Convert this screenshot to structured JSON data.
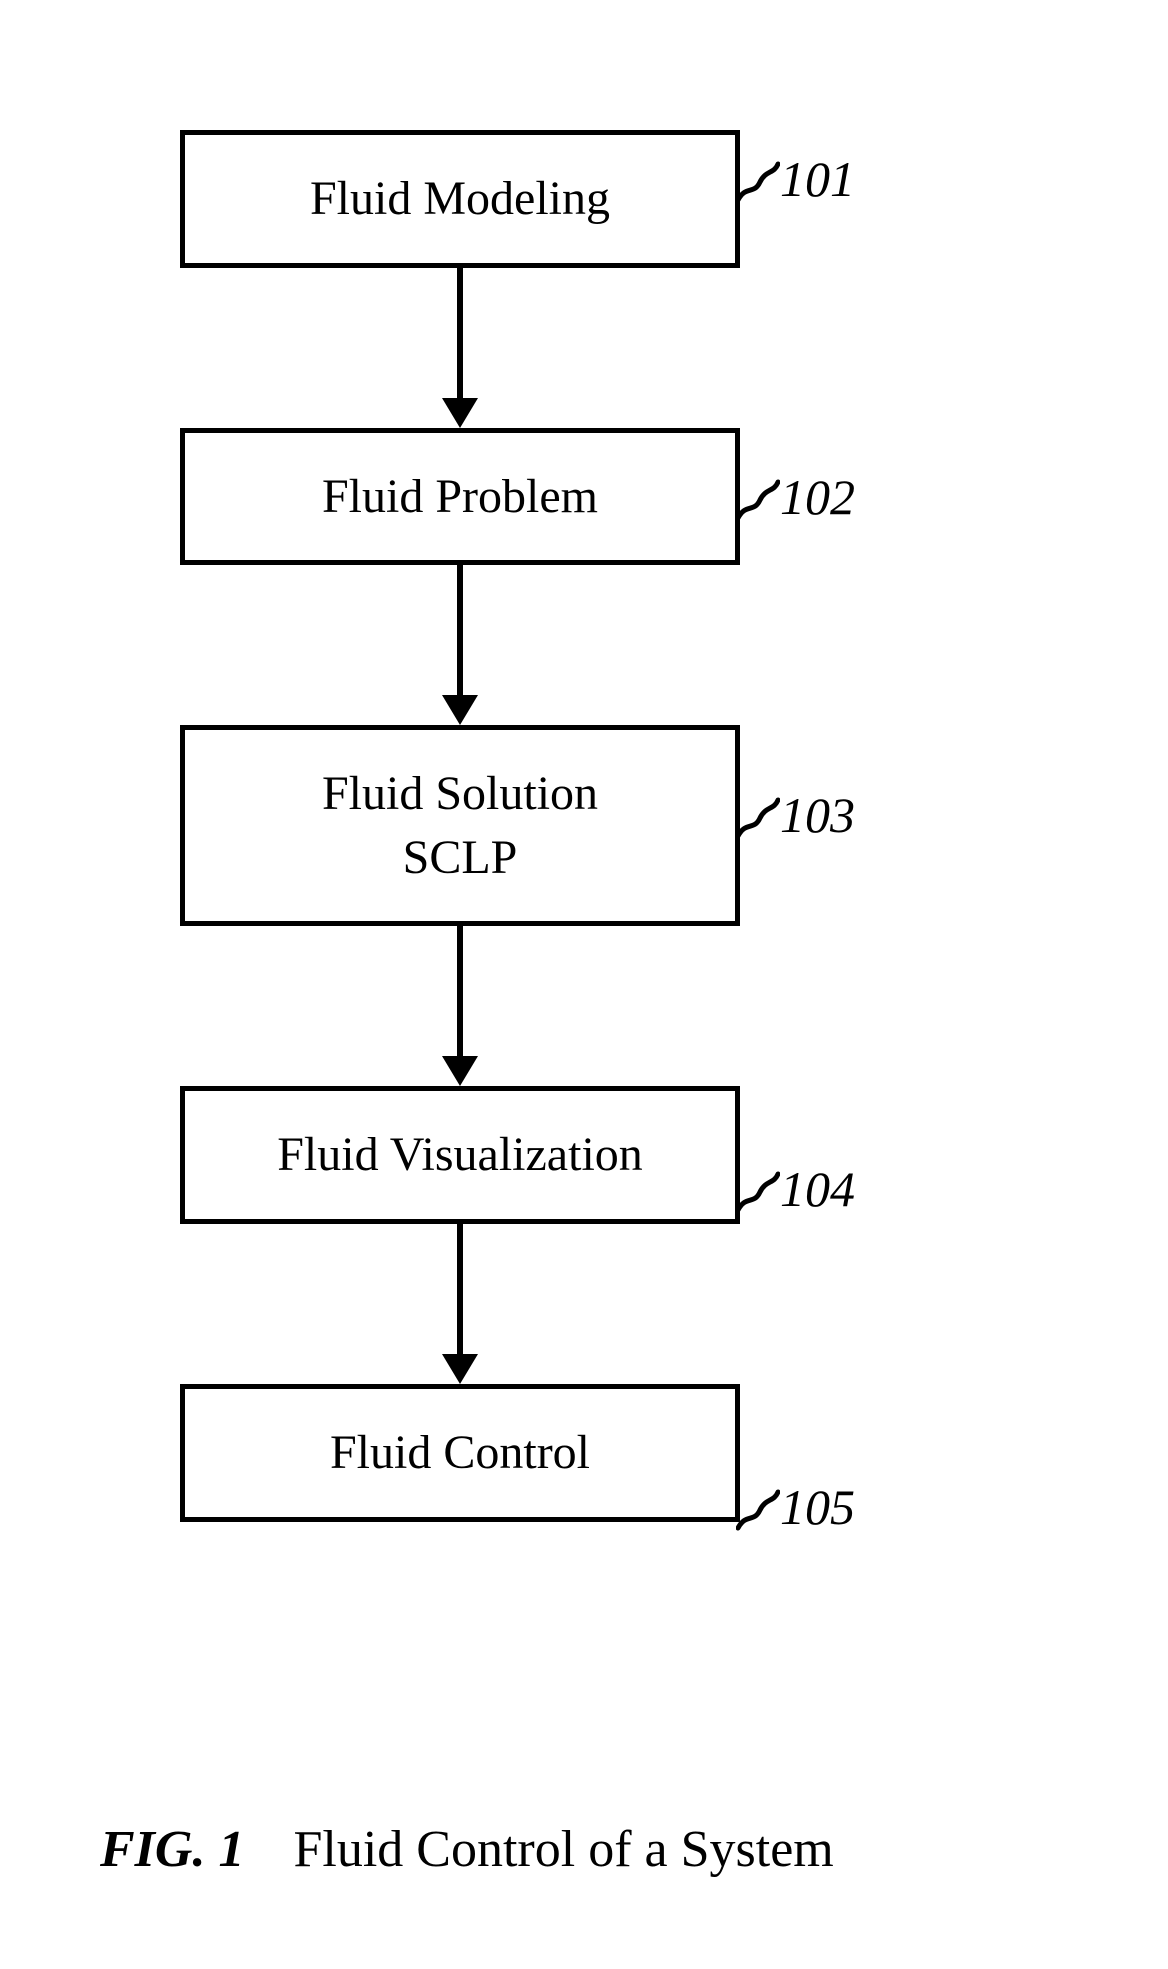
{
  "boxes": [
    {
      "line1": "Fluid Modeling",
      "line2": "",
      "ref": "101"
    },
    {
      "line1": "Fluid Problem",
      "line2": "",
      "ref": "102"
    },
    {
      "line1": "Fluid Solution",
      "line2": "SCLP",
      "ref": "103"
    },
    {
      "line1": "Fluid Visualization",
      "line2": "",
      "ref": "104"
    },
    {
      "line1": "Fluid Control",
      "line2": "",
      "ref": "105"
    }
  ],
  "caption": {
    "figure_label": "FIG. 1",
    "text": "Fluid Control of a System"
  }
}
